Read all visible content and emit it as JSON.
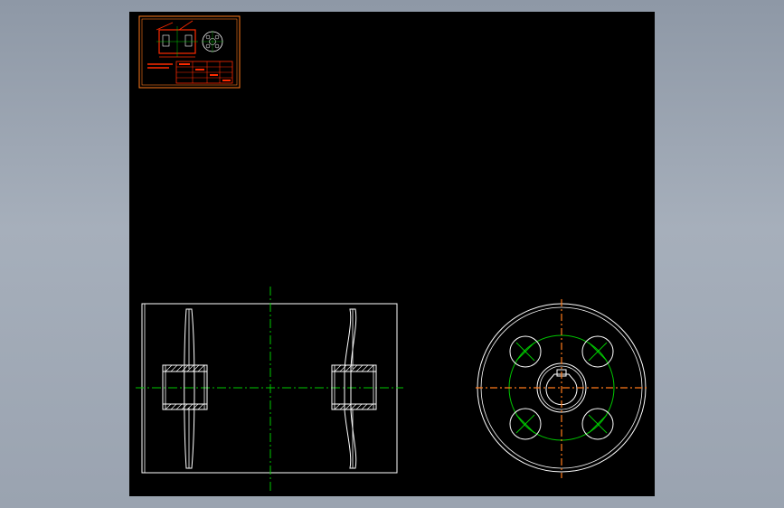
{
  "colors": {
    "window_background": "#9aa3b0",
    "canvas_background": "#000000",
    "geometry": "#ffffff",
    "center_line": "#00c800",
    "thumbnail_border": "#ff7a1a",
    "thumbnail_detail": "#ff2a00"
  },
  "thumbnail": {
    "icon": "drawing-thumbnail-icon"
  }
}
